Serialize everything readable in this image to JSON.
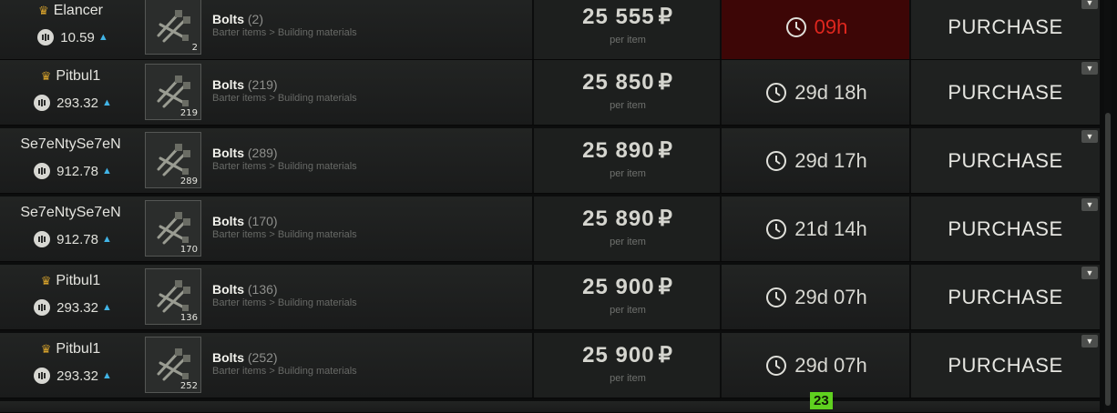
{
  "ui": {
    "per_item_label": "per item",
    "purchase_label": "PURCHASE",
    "currency_symbol": "₽",
    "fps_counter": "23",
    "icons": {
      "seller_rank": "crown-icon",
      "reputation": "reputation-badge-icon",
      "rating_trend": "arrow-up-icon",
      "timer": "clock-icon",
      "expand": "chevron-down-icon"
    }
  },
  "offers": [
    {
      "seller": "Elancer",
      "rating": "10.59",
      "item_name": "Bolts",
      "item_qty": "(2)",
      "thumb_count": "2",
      "category": "Barter items > Building materials",
      "price": "25 555",
      "time_left": "09h",
      "expiring": true
    },
    {
      "seller": "Pitbul1",
      "rating": "293.32",
      "item_name": "Bolts",
      "item_qty": "(219)",
      "thumb_count": "219",
      "category": "Barter items > Building materials",
      "price": "25 850",
      "time_left": "29d 18h",
      "expiring": false
    },
    {
      "seller": "Se7eNtySe7eN",
      "rating": "912.78",
      "item_name": "Bolts",
      "item_qty": "(289)",
      "thumb_count": "289",
      "category": "Barter items > Building materials",
      "price": "25 890",
      "time_left": "29d 17h",
      "expiring": false
    },
    {
      "seller": "Se7eNtySe7eN",
      "rating": "912.78",
      "item_name": "Bolts",
      "item_qty": "(170)",
      "thumb_count": "170",
      "category": "Barter items > Building materials",
      "price": "25 890",
      "time_left": "21d 14h",
      "expiring": false
    },
    {
      "seller": "Pitbul1",
      "rating": "293.32",
      "item_name": "Bolts",
      "item_qty": "(136)",
      "thumb_count": "136",
      "category": "Barter items > Building materials",
      "price": "25 900",
      "time_left": "29d 07h",
      "expiring": false
    },
    {
      "seller": "Pitbul1",
      "rating": "293.32",
      "item_name": "Bolts",
      "item_qty": "(252)",
      "thumb_count": "252",
      "category": "Barter items > Building materials",
      "price": "25 900",
      "time_left": "29d 07h",
      "expiring": false
    }
  ]
}
